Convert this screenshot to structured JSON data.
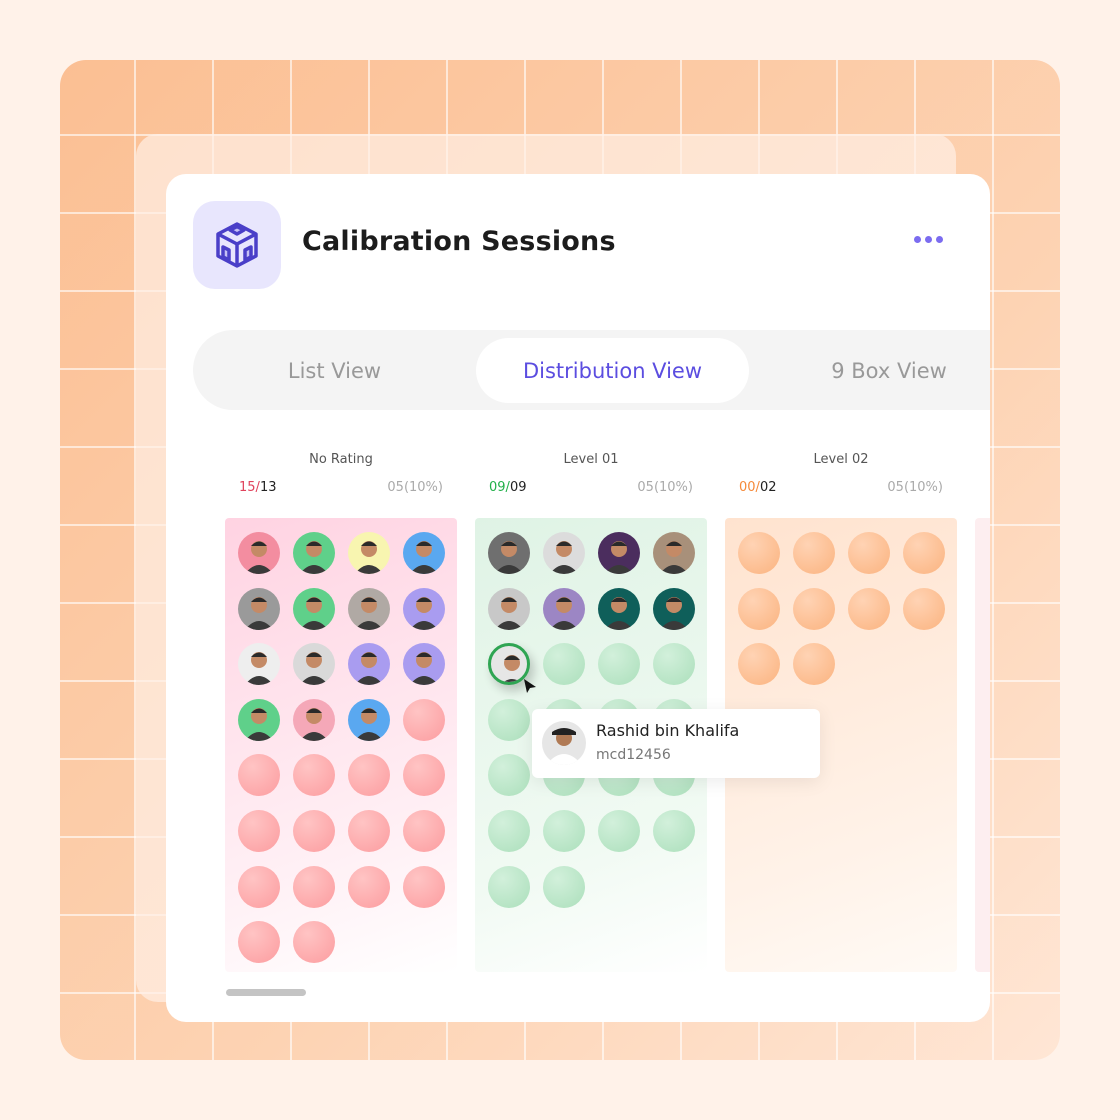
{
  "header": {
    "title": "Calibration Sessions",
    "logo_icon": "cube-icon",
    "more_icon": "more-dots-icon"
  },
  "tabs": [
    {
      "label": "List View",
      "active": false
    },
    {
      "label": "Distribution View",
      "active": true
    },
    {
      "label": "9 Box View",
      "active": false
    }
  ],
  "columns": [
    {
      "name": "No Rating",
      "count": "15",
      "total": "13",
      "percent": "05(10%)",
      "count_color": "#e0435c",
      "theme": "pink",
      "avatars": [
        "#f38da0",
        "#5fd08a",
        "#f8f5b0",
        "#5aa8f0",
        "#9a9a9a",
        "#5fd08a",
        "#b0a9a4",
        "#a99cf0",
        "#eeeeee",
        "#d9d9d9",
        "#a99cf0",
        "#a99cf0",
        "#5fd08a",
        "#f5a8b8",
        "#5aa8f0"
      ],
      "placeholders": 15
    },
    {
      "name": "Level 01",
      "count": "09",
      "total": "09",
      "percent": "05(10%)",
      "count_color": "#22b04a",
      "theme": "green",
      "avatars": [
        "#6f6f6f",
        "#dcdcdc",
        "#4b2d5e",
        "#a8907a",
        "#c8c8c8",
        "#9c86c4",
        "#0f5f5a",
        "#0f5f5a",
        "#e6e6e6"
      ],
      "placeholders": 17
    },
    {
      "name": "Level 02",
      "count": "00",
      "total": "02",
      "percent": "05(10%)",
      "count_color": "#f58a3a",
      "theme": "orange",
      "avatars": [],
      "placeholders": 10
    }
  ],
  "tooltip": {
    "name": "Rashid bin Khalifa",
    "id": "mcd12456"
  },
  "colors": {
    "accent": "#5b4de0",
    "pink": "#fda4a8",
    "green": "#b3e5c3",
    "orange": "#fdbb8c"
  }
}
